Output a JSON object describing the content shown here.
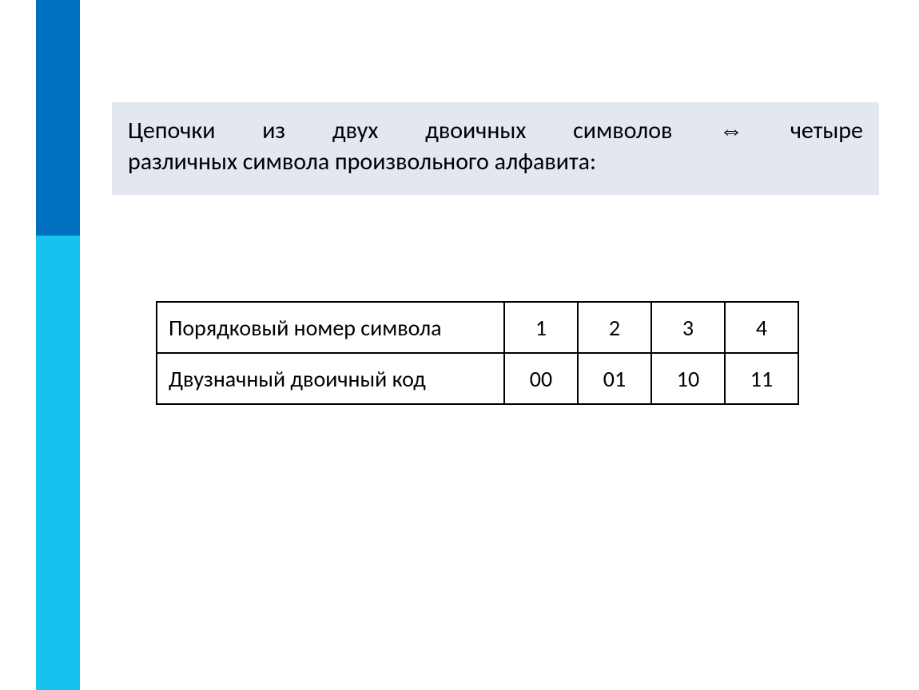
{
  "text": {
    "line1_words": [
      "Цепочки",
      "из",
      "двух",
      "двоичных",
      "символов",
      "⇔",
      "четыре"
    ],
    "line2": "различных символа произвольного алфавита:"
  },
  "table": {
    "rows": [
      {
        "label": "Порядковый номер символа",
        "cells": [
          "1",
          "2",
          "3",
          "4"
        ]
      },
      {
        "label": "Двузначный двоичный код",
        "cells": [
          "00",
          "01",
          "10",
          "11"
        ]
      }
    ]
  }
}
